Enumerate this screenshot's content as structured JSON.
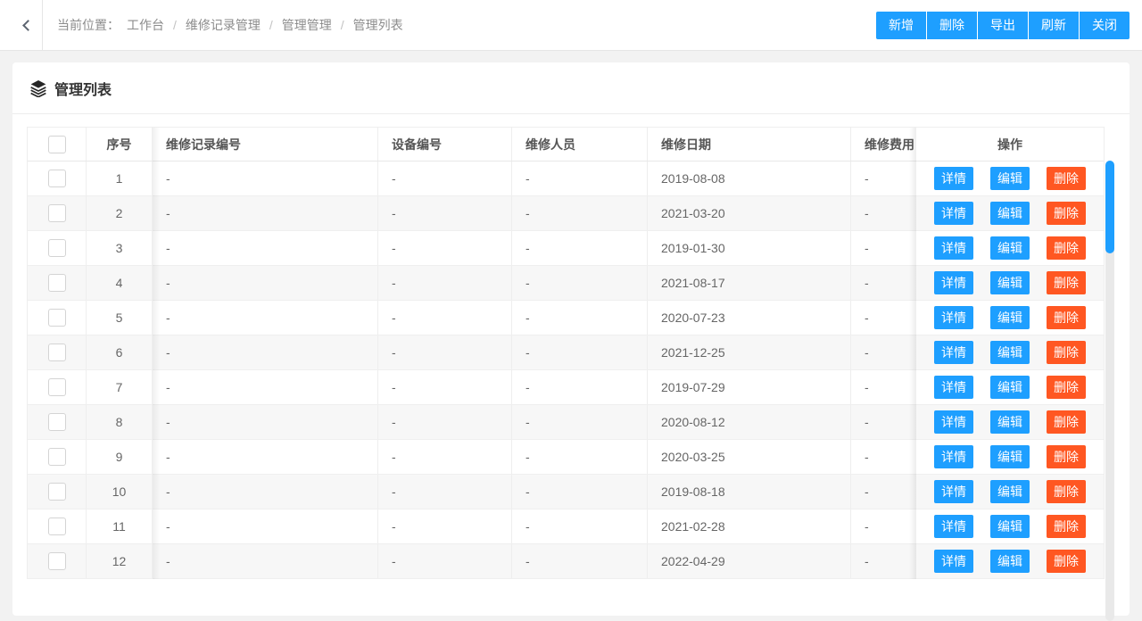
{
  "topbar": {
    "breadcrumb_label": "当前位置：",
    "breadcrumb_items": [
      "工作台",
      "维修记录管理",
      "管理管理",
      "管理列表"
    ],
    "breadcrumb_separator": "/",
    "toolbar_buttons": [
      "新增",
      "删除",
      "导出",
      "刷新",
      "关闭"
    ]
  },
  "panel": {
    "title": "管理列表",
    "title_icon": "layers-icon"
  },
  "table": {
    "columns": [
      "",
      "序号",
      "维修记录编号",
      "设备编号",
      "维修人员",
      "维修日期",
      "维修费用"
    ],
    "action_column_label": "操作",
    "action_buttons": [
      "详情",
      "编辑",
      "删除"
    ],
    "rows": [
      {
        "index": "1",
        "record_no": "-",
        "device_no": "-",
        "staff": "-",
        "date": "2019-08-08",
        "fee": "-"
      },
      {
        "index": "2",
        "record_no": "-",
        "device_no": "-",
        "staff": "-",
        "date": "2021-03-20",
        "fee": "-"
      },
      {
        "index": "3",
        "record_no": "-",
        "device_no": "-",
        "staff": "-",
        "date": "2019-01-30",
        "fee": "-"
      },
      {
        "index": "4",
        "record_no": "-",
        "device_no": "-",
        "staff": "-",
        "date": "2021-08-17",
        "fee": "-"
      },
      {
        "index": "5",
        "record_no": "-",
        "device_no": "-",
        "staff": "-",
        "date": "2020-07-23",
        "fee": "-"
      },
      {
        "index": "6",
        "record_no": "-",
        "device_no": "-",
        "staff": "-",
        "date": "2021-12-25",
        "fee": "-"
      },
      {
        "index": "7",
        "record_no": "-",
        "device_no": "-",
        "staff": "-",
        "date": "2019-07-29",
        "fee": "-"
      },
      {
        "index": "8",
        "record_no": "-",
        "device_no": "-",
        "staff": "-",
        "date": "2020-08-12",
        "fee": "-"
      },
      {
        "index": "9",
        "record_no": "-",
        "device_no": "-",
        "staff": "-",
        "date": "2020-03-25",
        "fee": "-"
      },
      {
        "index": "10",
        "record_no": "-",
        "device_no": "-",
        "staff": "-",
        "date": "2019-08-18",
        "fee": "-"
      },
      {
        "index": "11",
        "record_no": "-",
        "device_no": "-",
        "staff": "-",
        "date": "2021-02-28",
        "fee": "-"
      },
      {
        "index": "12",
        "record_no": "-",
        "device_no": "-",
        "staff": "-",
        "date": "2022-04-29",
        "fee": "-"
      }
    ]
  },
  "colors": {
    "primary": "#1E9FFF",
    "danger": "#FF5722",
    "scrollbar_thumb": "#1E9FFF"
  }
}
